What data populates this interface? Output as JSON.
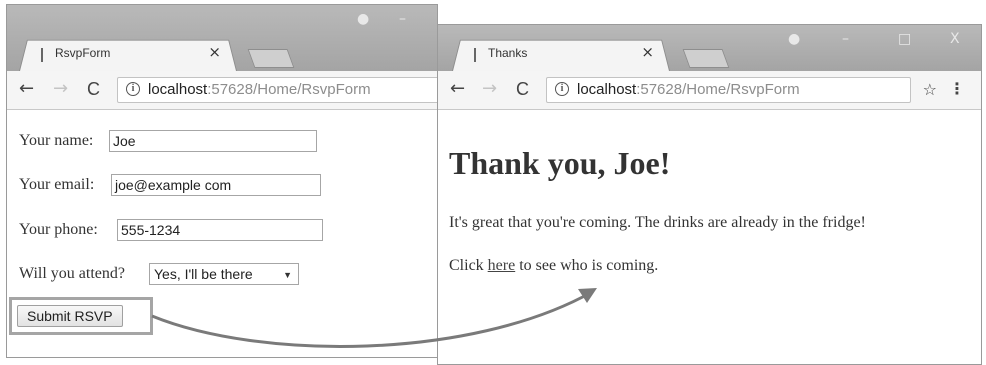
{
  "form_window": {
    "tab_title": "RsvpForm",
    "url_host": "localhost",
    "url_rest": ":57628/Home/RsvpForm",
    "fields": {
      "name_label": "Your name:",
      "name_value": "Joe",
      "email_label": "Your email:",
      "email_value": "joe@example com",
      "phone_label": "Your phone:",
      "phone_value": "555-1234",
      "attend_label": "Will you attend?",
      "attend_value": "Yes, I'll be there"
    },
    "submit_label": "Submit RSVP"
  },
  "thanks_window": {
    "tab_title": "Thanks",
    "url_host": "localhost",
    "url_rest": ":57628/Home/RsvpForm",
    "heading": "Thank you, Joe!",
    "message": "It's great that you're coming. The drinks are already in the fridge!",
    "link_prefix": "Click ",
    "link_text": "here",
    "link_suffix": " to see who is coming."
  },
  "icons": {
    "back": "←",
    "forward": "→",
    "reload": "C",
    "info": "i",
    "close_tab": "×",
    "star": "☆",
    "menu": "⋮",
    "minimize": "–",
    "maximize": "□",
    "close_window": "X",
    "profile": "●",
    "dropdown": "▼"
  },
  "colors": {
    "arrow": "#7a7a7a",
    "highlight_border": "#a5a5a5"
  }
}
